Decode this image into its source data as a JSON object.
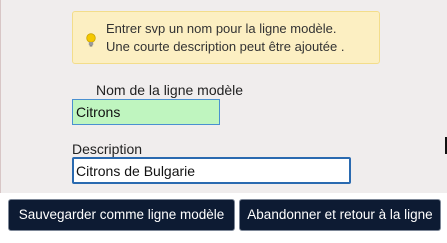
{
  "hint": {
    "line1": "Entrer svp un nom pour la ligne modèle.",
    "line2": "Une courte description peut être ajoutée .",
    "icon": "lightbulb-icon",
    "icon_color": "#f5c800"
  },
  "form": {
    "name_label": "Nom de la ligne modèle",
    "name_value": "Citrons",
    "description_label": "Description",
    "description_value": "Citrons de Bulgarie"
  },
  "buttons": {
    "save_label": "Sauvegarder comme ligne modèle",
    "abandon_label": "Abandonner et retour à la ligne"
  },
  "colors": {
    "hint_background": "#fcefc2",
    "name_field_background": "#bff5bf",
    "button_background": "#0d1b33"
  }
}
